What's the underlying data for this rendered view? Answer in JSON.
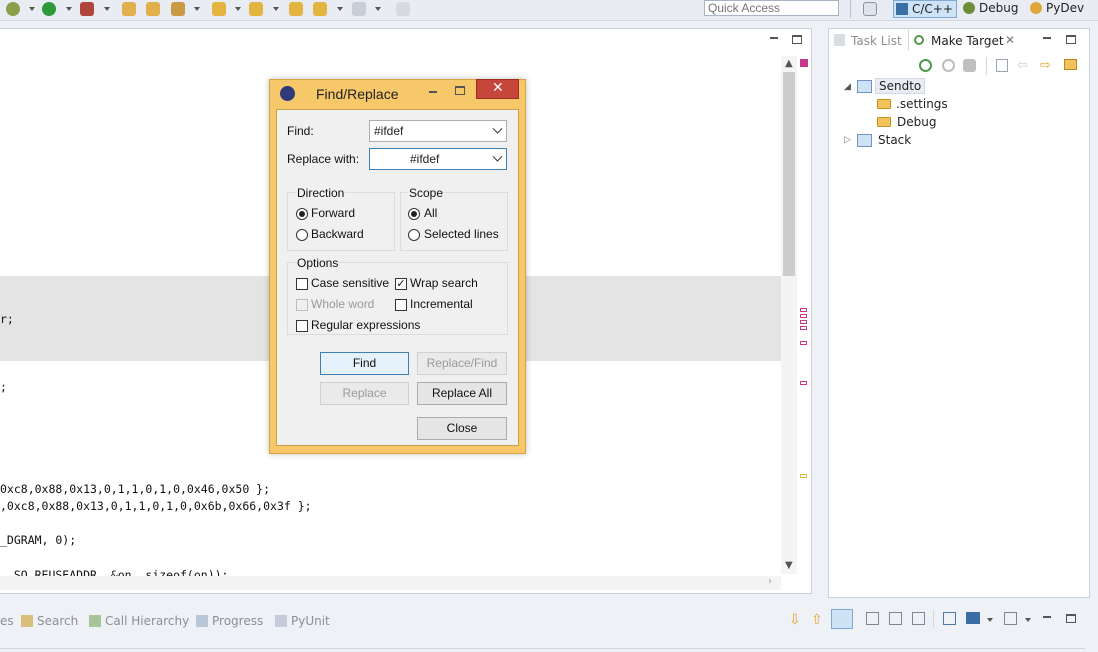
{
  "toolbar": {
    "quick_access_placeholder": "Quick Access",
    "perspectives": [
      {
        "label": "C/C++",
        "icon": "cpp-perspective-icon",
        "active": true
      },
      {
        "label": "Debug",
        "icon": "debug-perspective-icon"
      },
      {
        "label": "PyDev",
        "icon": "pydev-perspective-icon"
      }
    ]
  },
  "editor": {
    "code_lines": [
      "r;",
      ";",
      "0xc8,0x88,0x13,0,1,1,0,1,0,0x46,0x50 };",
      ",0xc8,0x88,0x13,0,1,1,0,1,0,0x6b,0x66,0x3f };",
      "_DGRAM, 0);",
      ", SO_REUSEADDR, &on, sizeof(on));"
    ],
    "highlight_color": "#e4e4e4"
  },
  "right_panel": {
    "tabs": [
      {
        "label": "Task List",
        "active": false
      },
      {
        "label": "Make Target",
        "active": true
      }
    ],
    "tree": {
      "sendto": "Sendto",
      "settings": ".settings",
      "debug": "Debug",
      "stack": "Stack"
    }
  },
  "bottom_tabs": [
    "es",
    "Search",
    "Call Hierarchy",
    "Progress",
    "PyUnit"
  ],
  "dialog": {
    "title": "Find/Replace",
    "find_label": "Find:",
    "find_value": "#ifdef",
    "replace_label": "Replace with:",
    "replace_value": "#ifdef",
    "direction": {
      "title": "Direction",
      "forward": "Forward",
      "backward": "Backward",
      "selected": "Forward"
    },
    "scope": {
      "title": "Scope",
      "all": "All",
      "selected_lines": "Selected lines",
      "selected": "All"
    },
    "options": {
      "title": "Options",
      "case_sensitive": "Case sensitive",
      "wrap_search": "Wrap search",
      "whole_word": "Whole word",
      "incremental": "Incremental",
      "regular_expressions": "Regular expressions",
      "checked": {
        "case_sensitive": false,
        "wrap_search": true,
        "whole_word": false,
        "incremental": false,
        "regular_expressions": false
      }
    },
    "buttons": {
      "find": "Find",
      "replace_find": "Replace/Find",
      "replace": "Replace",
      "replace_all": "Replace All",
      "close": "Close"
    },
    "colors": {
      "frame": "#f7c869",
      "close_button": "#c7463c",
      "accent": "#3c7fb1"
    }
  }
}
